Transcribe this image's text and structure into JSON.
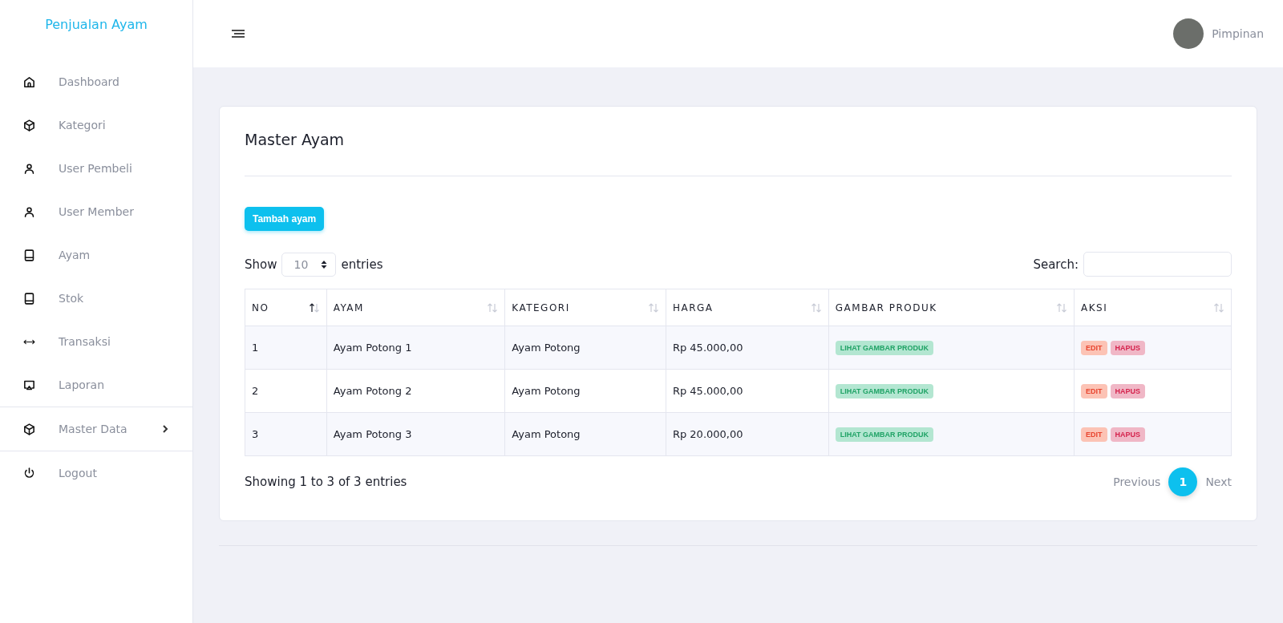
{
  "sidebar": {
    "brand": "Penjualan Ayam",
    "items": [
      {
        "label": "Dashboard",
        "selected": false
      },
      {
        "label": "Kategori",
        "selected": false
      },
      {
        "label": "User Pembeli",
        "selected": false
      },
      {
        "label": "User Member",
        "selected": false
      },
      {
        "label": "Ayam",
        "selected": false
      },
      {
        "label": "Stok",
        "selected": false
      },
      {
        "label": "Transaksi",
        "selected": false
      },
      {
        "label": "Laporan",
        "selected": false
      },
      {
        "label": "Master Data",
        "selected": false,
        "expanded": false
      },
      {
        "label": "Logout",
        "selected": false
      }
    ]
  },
  "header": {
    "user_name": "Pimpinan"
  },
  "card": {
    "title": "Master Ayam",
    "add_button": "Tambah ayam",
    "length": {
      "before": "Show",
      "value": "10",
      "after": "entries"
    },
    "search_label": "Search:",
    "table": {
      "columns": [
        {
          "label": "NO",
          "sorted": true
        },
        {
          "label": "AYAM",
          "sorted": false
        },
        {
          "label": "KATEGORI",
          "sorted": false
        },
        {
          "label": "HARGA",
          "sorted": false
        },
        {
          "label": "GAMBAR PRODUK",
          "sorted": false
        },
        {
          "label": "AKSI",
          "sorted": false
        }
      ],
      "rows": [
        {
          "no": "1",
          "ayam": "Ayam Potong 1",
          "kategori": "Ayam Potong",
          "harga": "Rp 45.000,00",
          "gambar": "LIHAT GAMBAR PRODUK",
          "edit": "EDIT",
          "hapus": "HAPUS"
        },
        {
          "no": "2",
          "ayam": "Ayam Potong 2",
          "kategori": "Ayam Potong",
          "harga": "Rp 45.000,00",
          "gambar": "LIHAT GAMBAR PRODUK",
          "edit": "EDIT",
          "hapus": "HAPUS"
        },
        {
          "no": "3",
          "ayam": "Ayam Potong 3",
          "kategori": "Ayam Potong",
          "harga": "Rp 20.000,00",
          "gambar": "LIHAT GAMBAR PRODUK",
          "edit": "EDIT",
          "hapus": "HAPUS"
        }
      ]
    },
    "info": "Showing 1 to 3 of 3 entries",
    "pagination": {
      "previous": "Previous",
      "pages": [
        {
          "label": "1",
          "selected": true
        }
      ],
      "next": "Next"
    }
  }
}
